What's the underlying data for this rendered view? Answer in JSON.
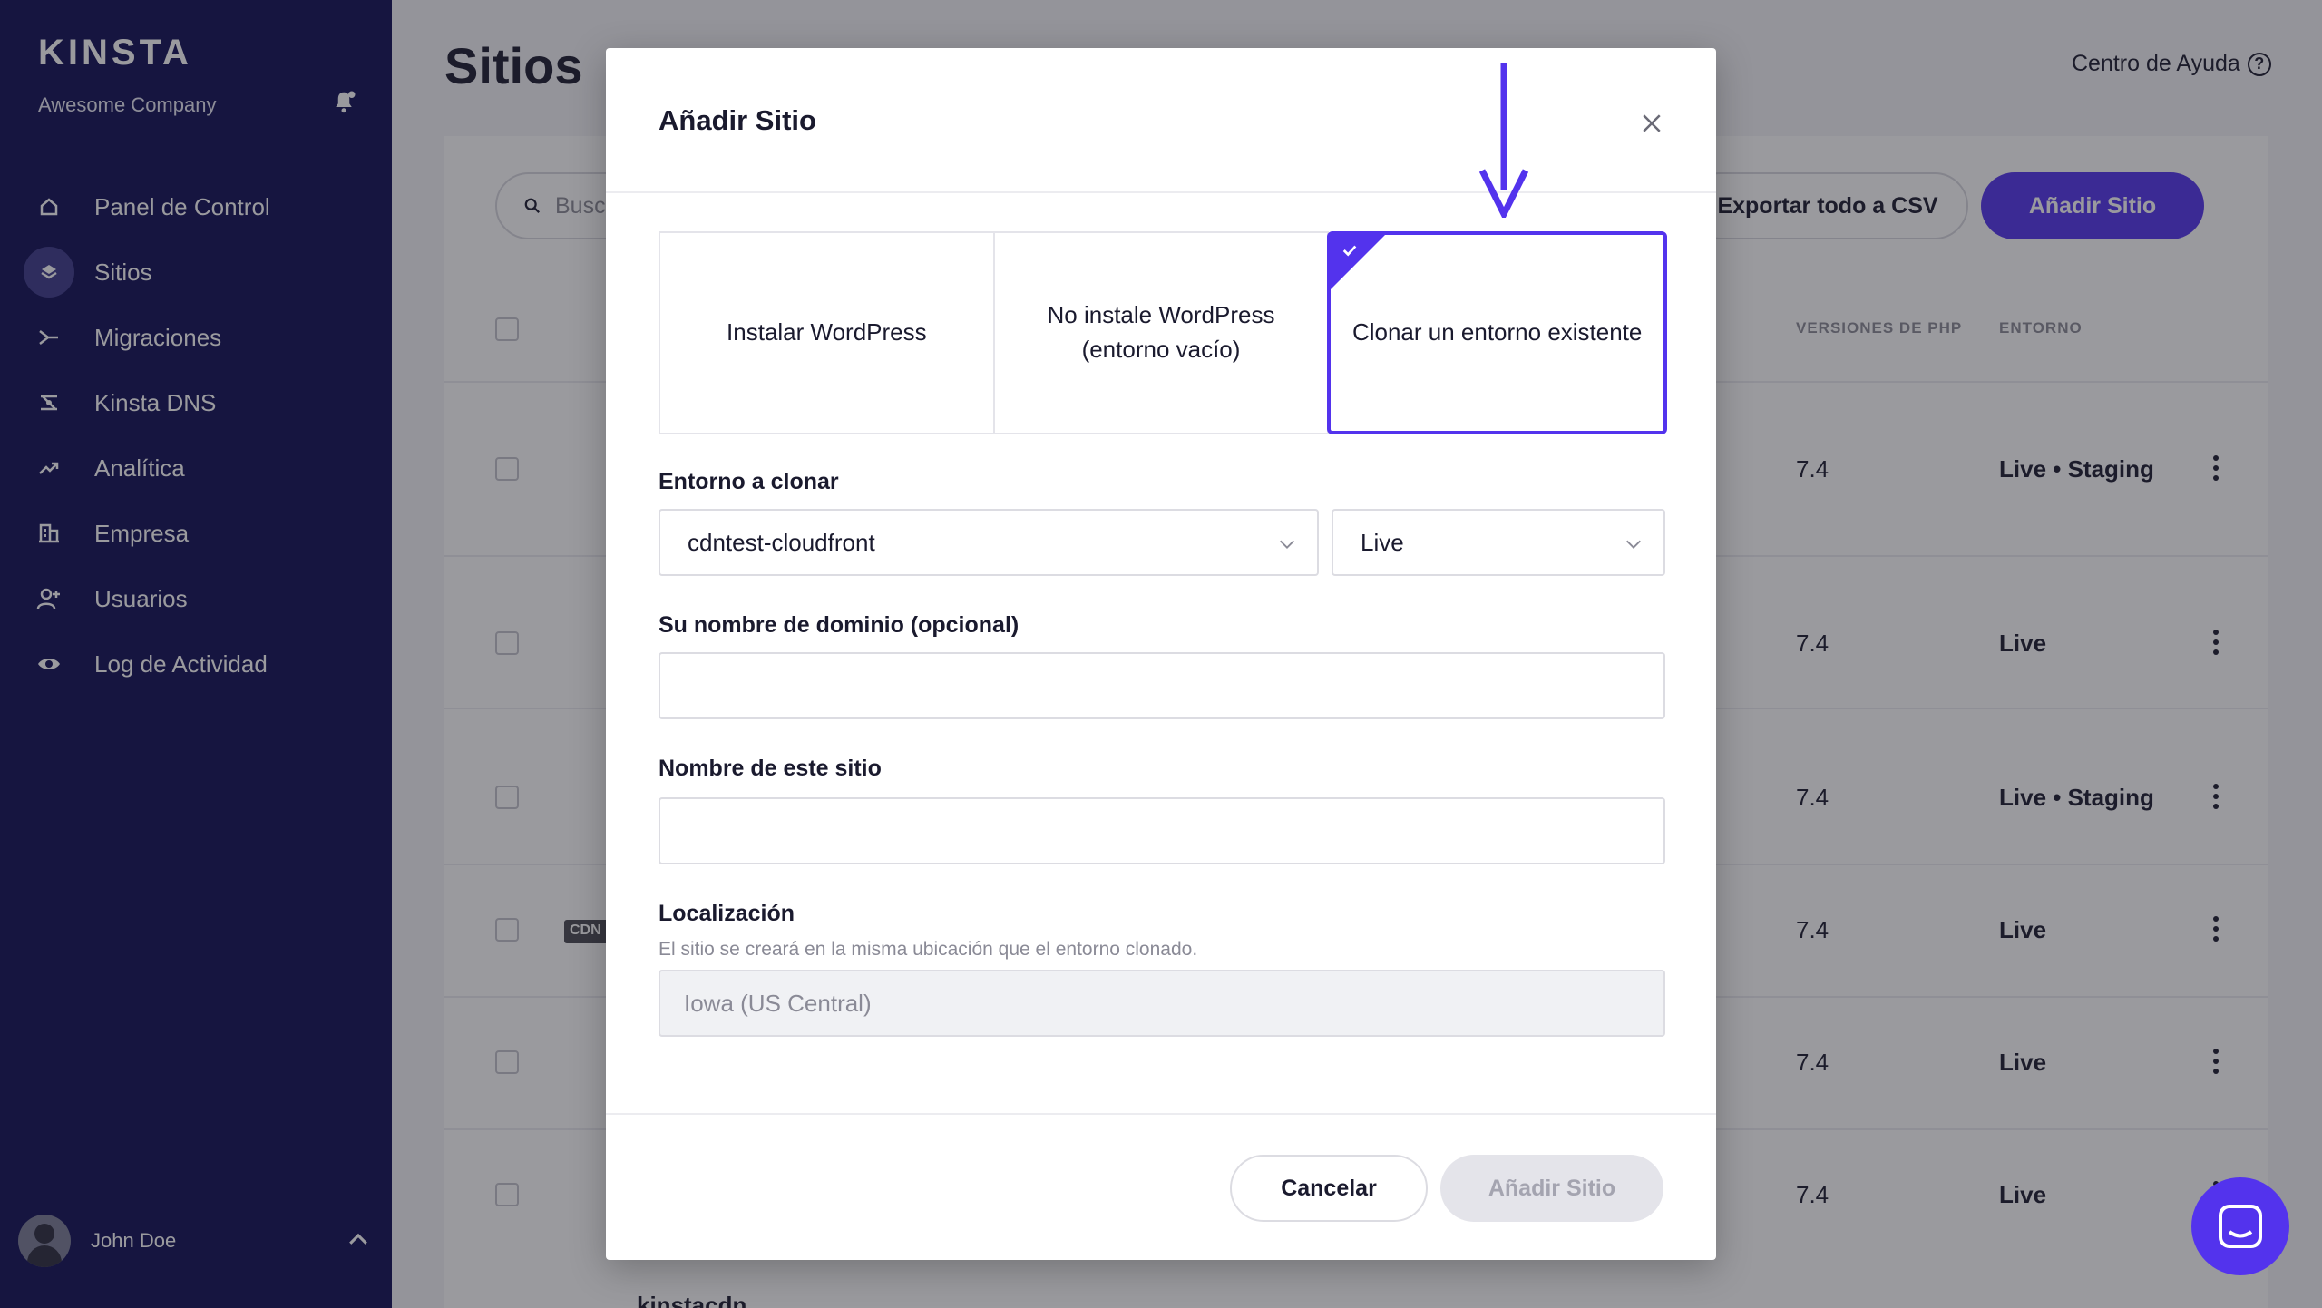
{
  "sidebar": {
    "logo": "KINSTA",
    "company": "Awesome Company",
    "nav": [
      {
        "label": "Panel de Control",
        "icon": "home-icon"
      },
      {
        "label": "Sitios",
        "icon": "layers-icon",
        "active": true
      },
      {
        "label": "Migraciones",
        "icon": "migration-icon"
      },
      {
        "label": "Kinsta DNS",
        "icon": "dns-icon"
      },
      {
        "label": "Analítica",
        "icon": "analytics-icon"
      },
      {
        "label": "Empresa",
        "icon": "building-icon"
      },
      {
        "label": "Usuarios",
        "icon": "add-user-icon"
      },
      {
        "label": "Log de Actividad",
        "icon": "eye-icon"
      }
    ],
    "user": {
      "name": "John Doe"
    }
  },
  "header": {
    "title": "Sitios",
    "help": "Centro de Ayuda"
  },
  "toolbar": {
    "search_placeholder": "Busc",
    "export_label": "Exportar todo a CSV",
    "add_label": "Añadir Sitio"
  },
  "table": {
    "headers": {
      "php": "VERSIONES DE PHP",
      "env": "ENTORNO"
    },
    "rows": [
      {
        "php": "7.4",
        "env": "Live • Staging"
      },
      {
        "php": "7.4",
        "env": "Live"
      },
      {
        "php": "7.4",
        "env": "Live • Staging"
      },
      {
        "php": "7.4",
        "env": "Live",
        "badge": "CDN"
      },
      {
        "php": "7.4",
        "env": "Live"
      },
      {
        "php": "7.4",
        "env": "Live"
      }
    ],
    "next_row_name": "kinstacdn"
  },
  "modal": {
    "title": "Añadir Sitio",
    "options": [
      {
        "label": "Instalar WordPress"
      },
      {
        "label": "No instale WordPress (entorno vacío)"
      },
      {
        "label": "Clonar un entorno existente",
        "selected": true
      }
    ],
    "clone_label": "Entorno a clonar",
    "clone_site_value": "cdntest-cloudfront",
    "clone_env_value": "Live",
    "domain_label": "Su nombre de dominio (opcional)",
    "domain_value": "",
    "site_name_label": "Nombre de este sitio",
    "site_name_value": "",
    "location_label": "Localización",
    "location_hint": "El sitio se creará en la misma ubicación que el entorno clonado.",
    "location_value": "Iowa (US Central)",
    "cancel_label": "Cancelar",
    "submit_label": "Añadir Sitio"
  },
  "colors": {
    "sidebar_bg": "#0f0d54",
    "accent": "#5333ed"
  }
}
